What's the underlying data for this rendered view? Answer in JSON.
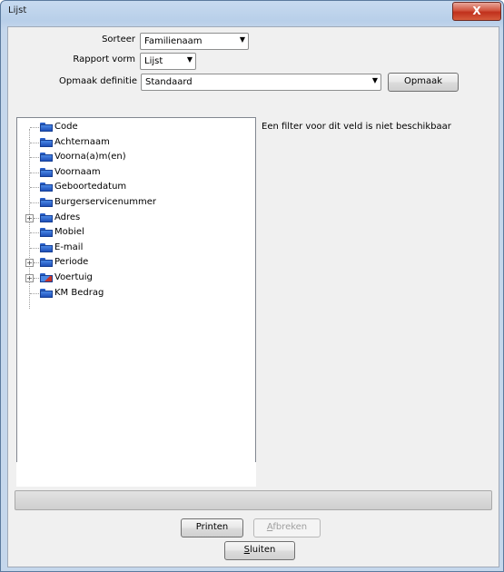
{
  "window": {
    "title": "Lijst",
    "close_label": "X"
  },
  "form": {
    "sorteer_label": "Sorteer",
    "sorteer_value": "Familienaam",
    "rapport_label": "Rapport vorm",
    "rapport_value": "Lijst",
    "opmaak_def_label": "Opmaak definitie",
    "opmaak_def_value": "Standaard",
    "opmaak_button": "Opmaak"
  },
  "tree": {
    "items": [
      {
        "label": "Code",
        "expandable": false,
        "icon": "folder-icon"
      },
      {
        "label": "Achternaam",
        "expandable": false,
        "icon": "folder-icon"
      },
      {
        "label": "Voorna(a)m(en)",
        "expandable": false,
        "icon": "folder-icon"
      },
      {
        "label": "Voornaam",
        "expandable": false,
        "icon": "folder-icon"
      },
      {
        "label": "Geboortedatum",
        "expandable": false,
        "icon": "folder-icon"
      },
      {
        "label": "Burgerservicenummer",
        "expandable": false,
        "icon": "folder-icon"
      },
      {
        "label": "Adres",
        "expandable": true,
        "icon": "folder-icon"
      },
      {
        "label": "Mobiel",
        "expandable": false,
        "icon": "folder-icon"
      },
      {
        "label": "E-mail",
        "expandable": false,
        "icon": "folder-icon"
      },
      {
        "label": "Periode",
        "expandable": true,
        "icon": "folder-icon"
      },
      {
        "label": "Voertuig",
        "expandable": true,
        "icon": "folder-car-icon"
      },
      {
        "label": "KM Bedrag",
        "expandable": false,
        "icon": "folder-icon"
      }
    ]
  },
  "filter_message": "Een filter voor dit veld is niet beschikbaar",
  "buttons": {
    "printen": "Printen",
    "afbreken_first": "A",
    "afbreken_rest": "fbreken",
    "sluiten_first": "S",
    "sluiten_rest": "luiten"
  },
  "colors": {
    "close_button": "#c0301c",
    "folder": "#2a60c8"
  }
}
